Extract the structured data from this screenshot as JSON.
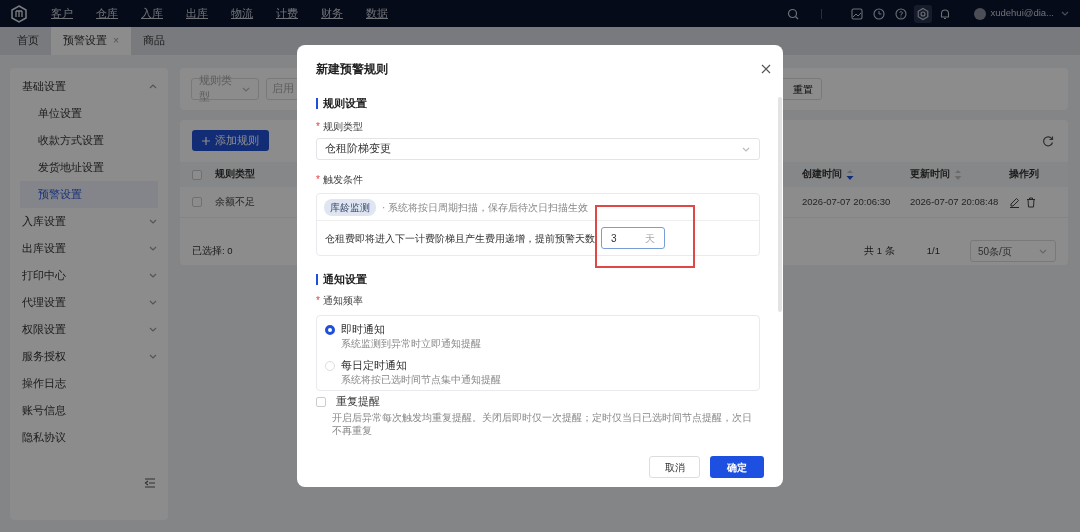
{
  "nav": {
    "menu": [
      "客户",
      "仓库",
      "入库",
      "出库",
      "物流",
      "计费",
      "财务",
      "数据"
    ],
    "tools": [
      {
        "kind": "image",
        "selected": false
      },
      {
        "kind": "clock",
        "selected": false
      },
      {
        "kind": "help",
        "selected": false
      },
      {
        "kind": "settings",
        "selected": true
      },
      {
        "kind": "bell",
        "selected": false
      }
    ],
    "user": "xudehui@dia..."
  },
  "tabs": [
    {
      "label": "首页",
      "selected": false
    },
    {
      "label": "预警设置",
      "selected": true,
      "close": "×"
    },
    {
      "label": "商品",
      "selected": false
    }
  ],
  "sidebar": {
    "items": [
      {
        "label": "基础设置",
        "kind": "group",
        "expanded": true,
        "children": [
          {
            "label": "单位设置",
            "selected": false
          },
          {
            "label": "收款方式设置",
            "selected": false
          },
          {
            "label": "发货地址设置",
            "selected": false
          },
          {
            "label": "预警设置",
            "selected": true
          }
        ]
      },
      {
        "label": "入库设置",
        "kind": "group",
        "expanded": false
      },
      {
        "label": "出库设置",
        "kind": "group",
        "expanded": false
      },
      {
        "label": "打印中心",
        "kind": "group",
        "expanded": false
      },
      {
        "label": "代理设置",
        "kind": "group",
        "expanded": false
      },
      {
        "label": "权限设置",
        "kind": "group",
        "expanded": false
      },
      {
        "label": "服务授权",
        "kind": "group",
        "expanded": false
      },
      {
        "label": "操作日志",
        "kind": "link"
      },
      {
        "label": "账号信息",
        "kind": "link"
      },
      {
        "label": "隐私协议",
        "kind": "link"
      }
    ]
  },
  "filters": [
    {
      "placeholder": "规则类型"
    },
    {
      "placeholder": "启用"
    }
  ],
  "reset_button": "重置",
  "toolbar": {
    "add_button": "添加规则"
  },
  "table": {
    "header_checked": false,
    "columns": [
      {
        "label": "规则类型"
      },
      {
        "label": "创建时间",
        "sort_active": true
      },
      {
        "label": "更新时间",
        "sort_active": false
      },
      {
        "label": "操作列"
      }
    ],
    "rows": [
      {
        "checked": false,
        "cells": [
          "余额不足",
          "2026-07-07 20:06:30",
          "2026-07-07 20:08:48"
        ]
      }
    ]
  },
  "selection_count": "已选择: 0",
  "pagination": {
    "total": "共 1 条",
    "page": "1/1",
    "page_size": "50条/页"
  },
  "dialog": {
    "title": "新建预警规则",
    "rule_section": "规则设置",
    "rule_type": {
      "required_mark": "*",
      "label": "规则类型",
      "value": "仓租阶梯变更"
    },
    "trigger": {
      "required_mark": "*",
      "label": "触发条件",
      "tag": "库龄监测",
      "hint": "· 系统将按日周期扫描，保存后待次日扫描生效",
      "text": "仓租费即将进入下一计费阶梯且产生费用递增，提前预警天数",
      "days": "3",
      "unit": "天",
      "highlighted": true
    },
    "notify_section": "通知设置",
    "frequency": {
      "required_mark": "*",
      "label": "通知频率",
      "options": [
        {
          "label": "即时通知",
          "desc": "系统监测到异常时立即通知提醒",
          "selected": true
        },
        {
          "label": "每日定时通知",
          "desc": "系统将按已选时间节点集中通知提醒",
          "selected": false
        }
      ]
    },
    "repeat": {
      "label": "重复提醒",
      "checked": false,
      "desc": "开启后异常每次触发均重复提醒。关闭后即时仅一次提醒；定时仅当日已选时间节点提醒，次日不再重复"
    },
    "cancel": "取消",
    "ok": "确定"
  }
}
